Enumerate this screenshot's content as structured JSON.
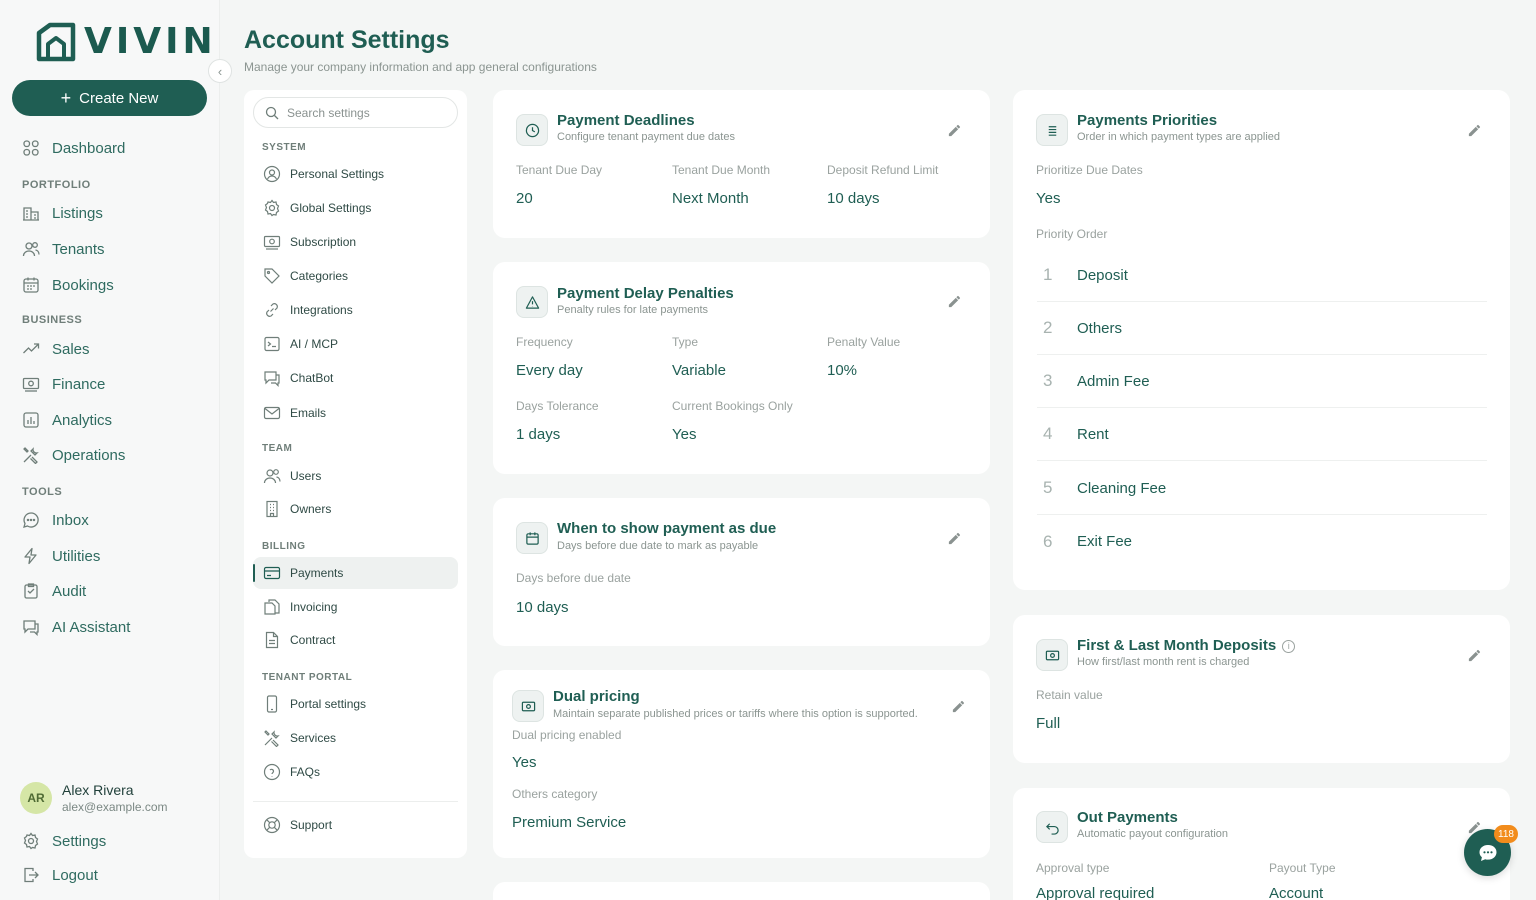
{
  "brand": {
    "name": "VIVIN",
    "color": "#1f5e53"
  },
  "sidebar": {
    "create_label": "Create New",
    "dashboard": "Dashboard",
    "sections": {
      "portfolio": "PORTFOLIO",
      "business": "BUSINESS",
      "tools": "TOOLS"
    },
    "items": {
      "listings": "Listings",
      "tenants": "Tenants",
      "bookings": "Bookings",
      "sales": "Sales",
      "finance": "Finance",
      "analytics": "Analytics",
      "operations": "Operations",
      "inbox": "Inbox",
      "utilities": "Utilities",
      "audit": "Audit",
      "ai_assistant": "AI Assistant"
    },
    "user": {
      "initials": "AR",
      "name": "Alex Rivera",
      "email": "alex@example.com"
    },
    "settings": "Settings",
    "logout": "Logout"
  },
  "header": {
    "title": "Account Settings",
    "subtitle": "Manage your company information and app general configurations"
  },
  "settings_nav": {
    "search_placeholder": "Search settings",
    "system_label": "SYSTEM",
    "personal": "Personal Settings",
    "global": "Global Settings",
    "subscription": "Subscription",
    "categories": "Categories",
    "integrations": "Integrations",
    "ai_mcp": "AI / MCP",
    "chatbot": "ChatBot",
    "emails": "Emails",
    "team_label": "TEAM",
    "users": "Users",
    "owners": "Owners",
    "billing_label": "BILLING",
    "payments": "Payments",
    "invoicing": "Invoicing",
    "contract": "Contract",
    "portal_label": "TENANT PORTAL",
    "portal_settings": "Portal settings",
    "services": "Services",
    "faqs": "FAQs",
    "support": "Support"
  },
  "deadlines": {
    "title": "Payment Deadlines",
    "subtitle": "Configure tenant payment due dates",
    "due_day_label": "Tenant Due Day",
    "due_day": "20",
    "due_month_label": "Tenant Due Month",
    "due_month": "Next Month",
    "refund_label": "Deposit Refund Limit",
    "refund": "10 days"
  },
  "penalties": {
    "title": "Payment Delay Penalties",
    "subtitle": "Penalty rules for late payments",
    "frequency_label": "Frequency",
    "frequency": "Every day",
    "type_label": "Type",
    "type": "Variable",
    "value_label": "Penalty Value",
    "value": "10%",
    "tolerance_label": "Days Tolerance",
    "tolerance": "1 days",
    "current_label": "Current Bookings Only",
    "current": "Yes"
  },
  "show_due": {
    "title": "When to show payment as due",
    "subtitle": "Days before due date to mark as payable",
    "days_label": "Days before due date",
    "days": "10 days"
  },
  "dual": {
    "title": "Dual pricing",
    "subtitle": "Maintain separate published prices or tariffs where this option is supported.",
    "enabled_label": "Dual pricing enabled",
    "enabled": "Yes",
    "category_label": "Others category",
    "category": "Premium Service"
  },
  "priorities": {
    "title": "Payments Priorities",
    "subtitle": "Order in which payment types are applied",
    "prioritize_label": "Prioritize Due Dates",
    "prioritize": "Yes",
    "order_label": "Priority Order",
    "order": [
      {
        "num": "1",
        "label": "Deposit"
      },
      {
        "num": "2",
        "label": "Others"
      },
      {
        "num": "3",
        "label": "Admin Fee"
      },
      {
        "num": "4",
        "label": "Rent"
      },
      {
        "num": "5",
        "label": "Cleaning Fee"
      },
      {
        "num": "6",
        "label": "Exit Fee"
      }
    ]
  },
  "deposits": {
    "title": "First & Last Month Deposits",
    "info": "i",
    "subtitle": "How first/last month rent is charged",
    "retain_label": "Retain value",
    "retain": "Full"
  },
  "out_payments": {
    "title": "Out Payments",
    "subtitle": "Automatic payout configuration",
    "approval_label": "Approval type",
    "approval": "Approval required",
    "payout_label": "Payout Type",
    "payout": "Account"
  },
  "chat": {
    "badge": "118"
  }
}
